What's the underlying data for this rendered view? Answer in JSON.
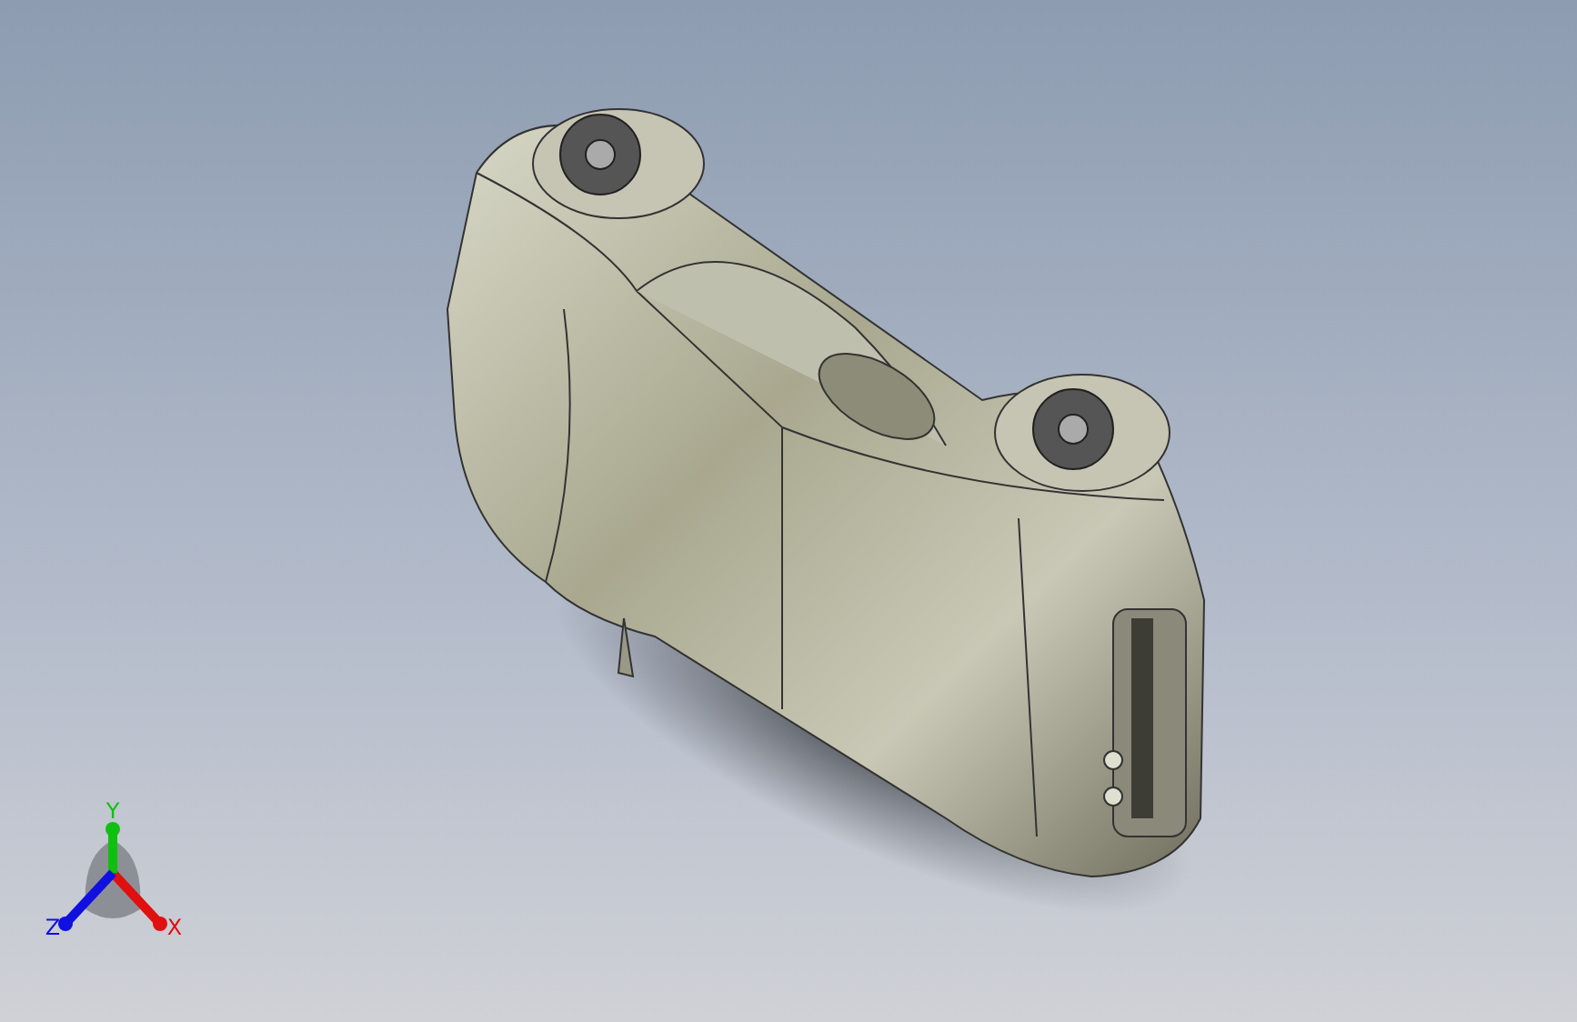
{
  "triad": {
    "axes": [
      {
        "label": "X",
        "color": "#e01010"
      },
      {
        "label": "Y",
        "color": "#10c010"
      },
      {
        "label": "Z",
        "color": "#1010e0"
      }
    ]
  }
}
